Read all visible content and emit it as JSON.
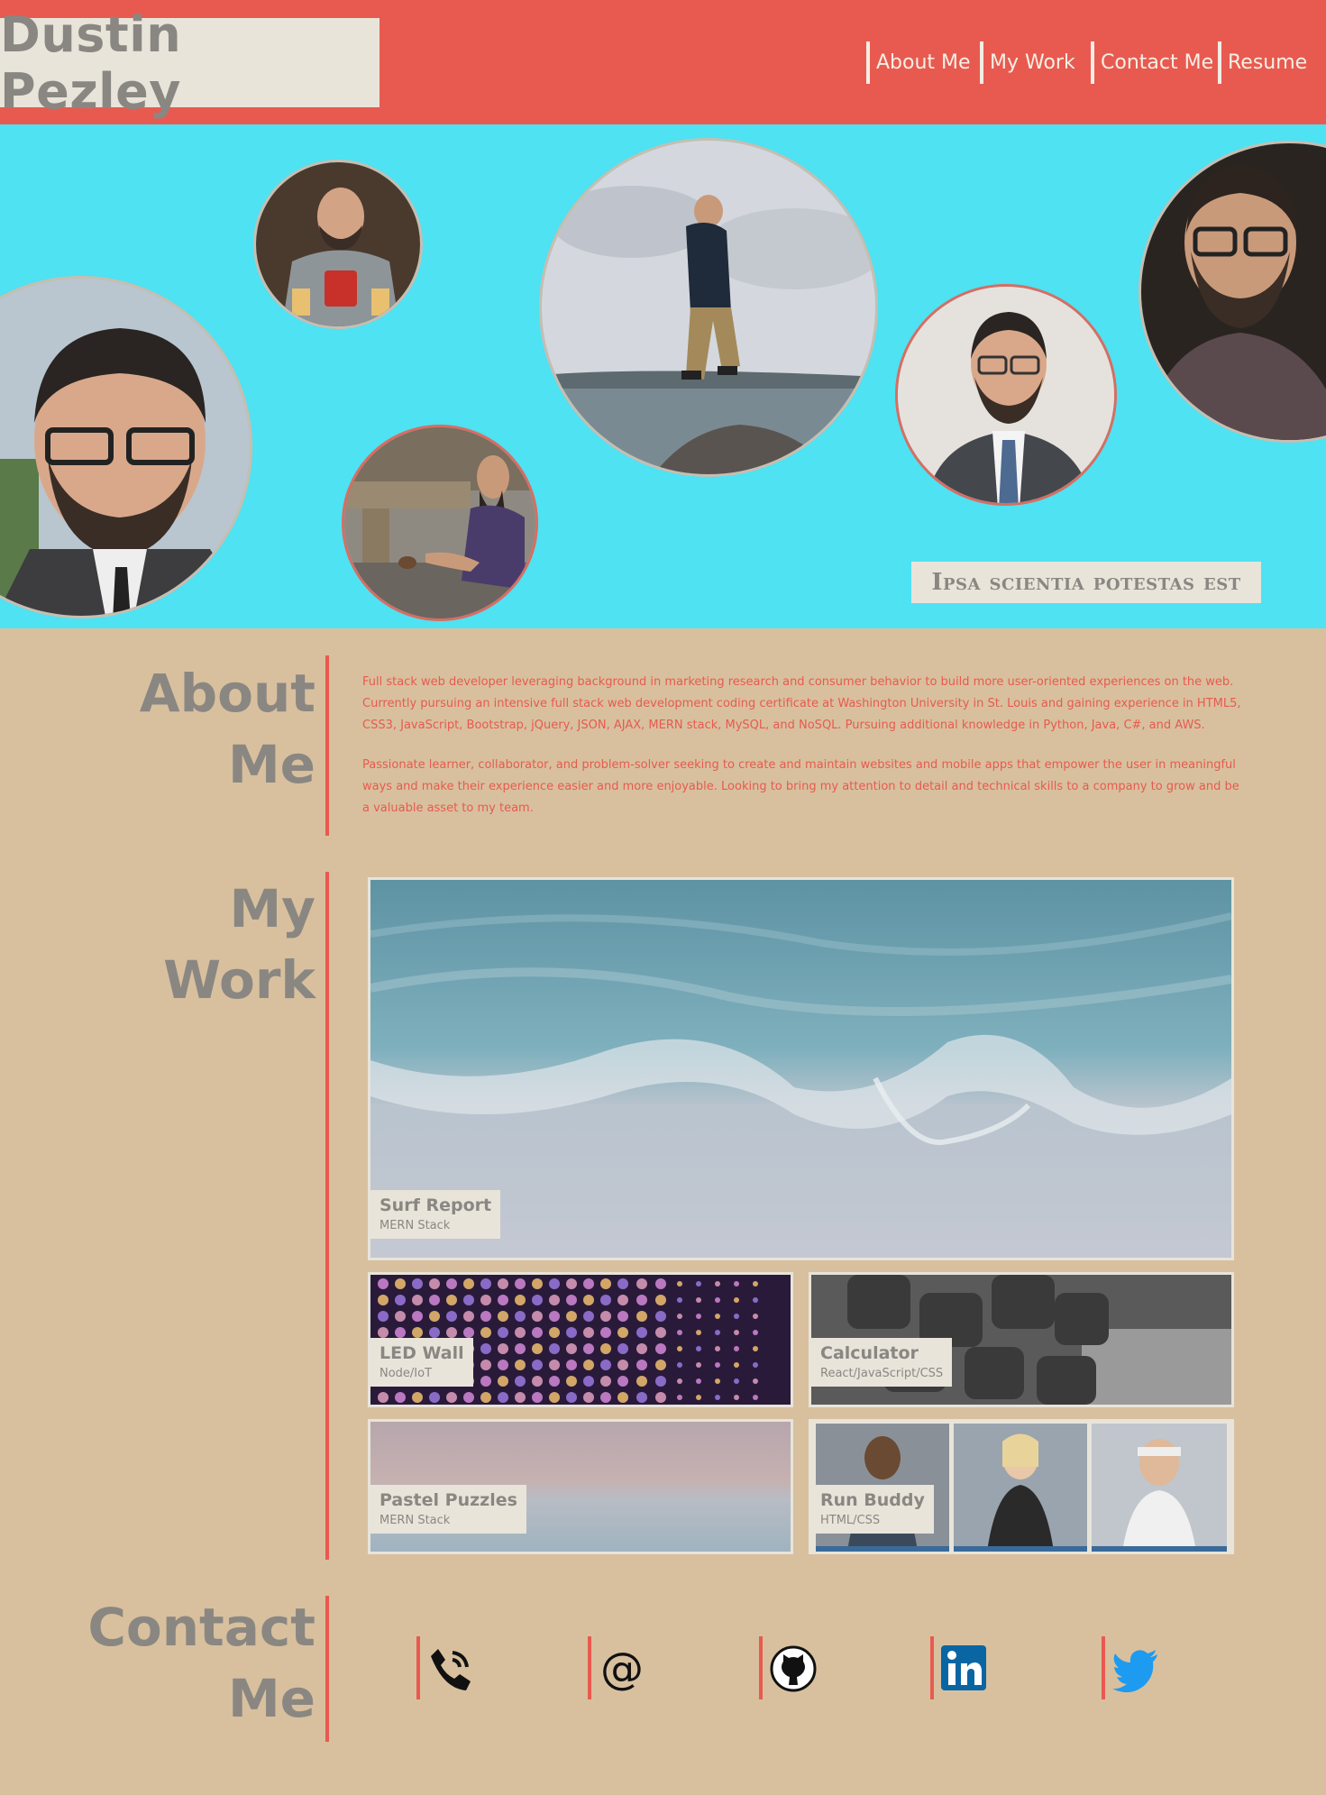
{
  "header": {
    "name": "Dustin Pezley",
    "nav": [
      "About Me",
      "My Work",
      "Contact Me",
      "Resume"
    ]
  },
  "hero": {
    "motto": "Ipsa scientia potestas est"
  },
  "about": {
    "title_line1": "About",
    "title_line2": "Me",
    "paragraph1": "Full stack web developer leveraging background in marketing research and consumer behavior to build more user-oriented experiences on the web. Currently pursuing an intensive full stack web development coding certificate at Washington University in St. Louis and gaining experience in HTML5, CSS3, JavaScript, Bootstrap, jQuery, JSON, AJAX, MERN stack, MySQL, and NoSQL. Pursuing additional knowledge in Python, Java, C#, and AWS.",
    "paragraph2": "Passionate learner, collaborator, and problem-solver seeking to create and maintain websites and mobile apps that empower the user in meaningful ways and make their experience easier and more enjoyable. Looking to bring my attention to detail and technical skills to a company to grow and be a valuable asset to my team."
  },
  "work": {
    "title_line1": "My",
    "title_line2": "Work",
    "projects": [
      {
        "title": "Surf Report",
        "stack": "MERN Stack"
      },
      {
        "title": "LED Wall",
        "stack": "Node/IoT"
      },
      {
        "title": "Calculator",
        "stack": "React/JavaScript/CSS"
      },
      {
        "title": "Pastel Puzzles",
        "stack": "MERN Stack"
      },
      {
        "title": "Run Buddy",
        "stack": "HTML/CSS"
      }
    ]
  },
  "contact": {
    "title_line1": "Contact",
    "title_line2": "Me",
    "icons": [
      "phone-icon",
      "email-icon",
      "github-icon",
      "linkedin-icon",
      "twitter-icon"
    ]
  },
  "colors": {
    "header": "#e85a50",
    "hero": "#4ee2f2",
    "body": "#d8c09e",
    "label_bg": "#e8e4da",
    "muted_text": "#8a8782"
  }
}
